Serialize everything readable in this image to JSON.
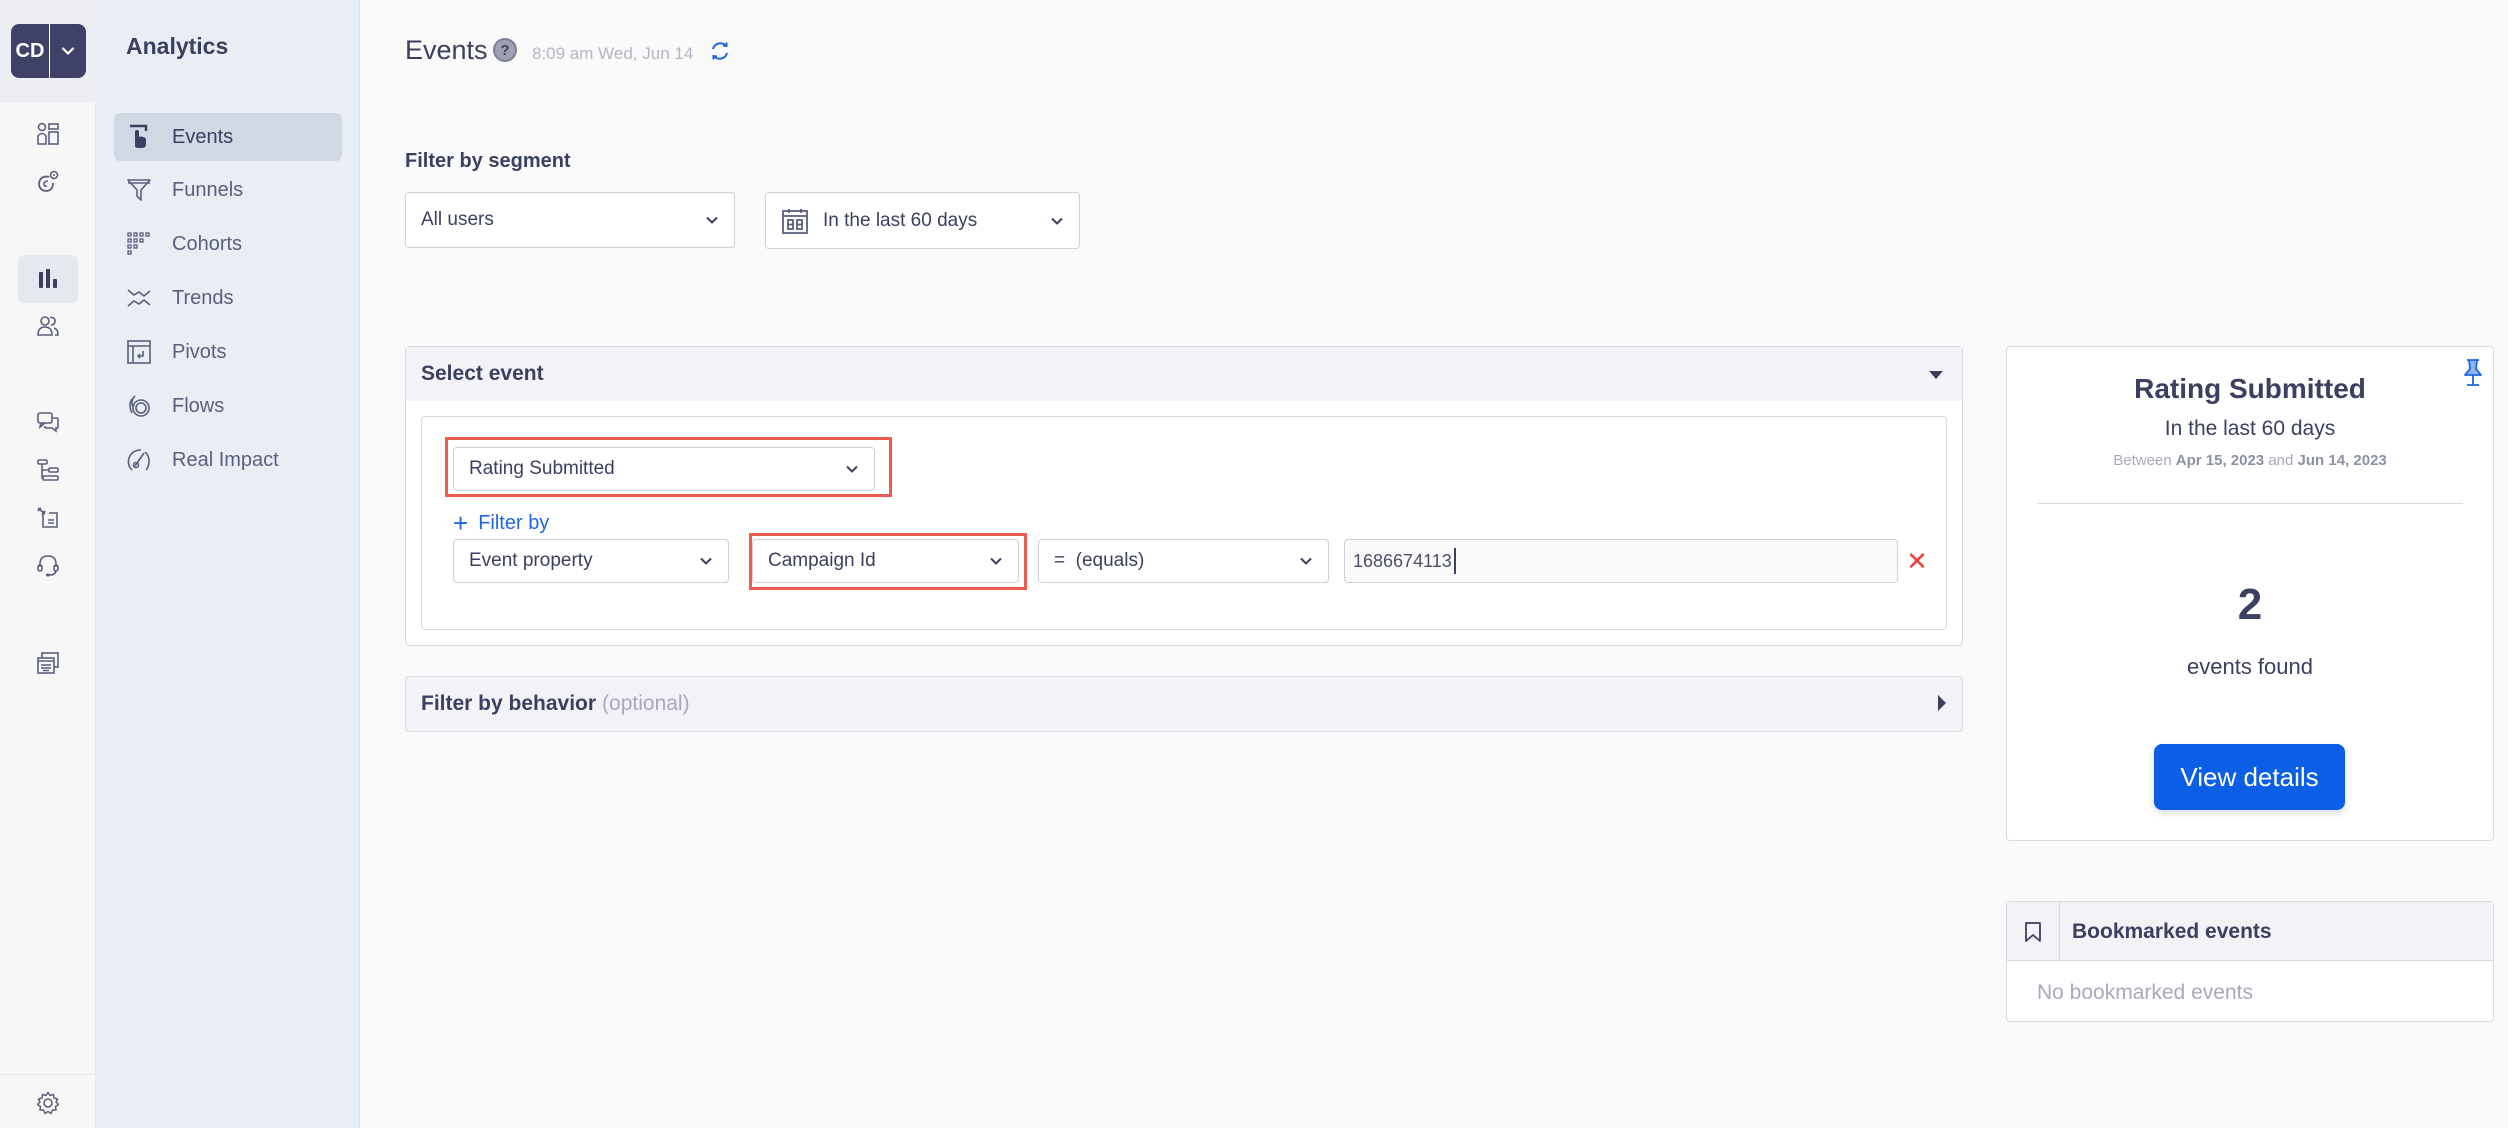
{
  "rail": {
    "logo_initials": "CD",
    "icons": [
      "dashboard-icon",
      "engagement-icon",
      "analytics-icon",
      "users-icon",
      "messages-icon",
      "journeys-icon",
      "campaigns-icon",
      "support-icon",
      "templates-icon",
      "settings-icon"
    ],
    "active": "analytics-icon"
  },
  "subnav": {
    "title": "Analytics",
    "items": [
      {
        "label": "Events",
        "icon": "tap-icon",
        "active": true
      },
      {
        "label": "Funnels",
        "icon": "funnel-icon",
        "active": false
      },
      {
        "label": "Cohorts",
        "icon": "cohorts-icon",
        "active": false
      },
      {
        "label": "Trends",
        "icon": "trends-icon",
        "active": false
      },
      {
        "label": "Pivots",
        "icon": "pivots-icon",
        "active": false
      },
      {
        "label": "Flows",
        "icon": "flows-icon",
        "active": false
      },
      {
        "label": "Real Impact",
        "icon": "real-impact-icon",
        "active": false
      }
    ]
  },
  "header": {
    "title": "Events",
    "help": "?",
    "timestamp": "8:09 am Wed, Jun 14"
  },
  "segment": {
    "label": "Filter by segment",
    "users_value": "All users",
    "date_value": "In the last 60 days"
  },
  "select_event": {
    "title": "Select event",
    "event_value": "Rating Submitted",
    "filter_by_label": "Filter by",
    "filter": {
      "type_value": "Event property",
      "property_value": "Campaign Id",
      "operator_value": "=  (equals)",
      "value": "1686674113",
      "remove_label": "✕"
    }
  },
  "behavior": {
    "title": "Filter by behavior",
    "optional": "(optional)"
  },
  "summary": {
    "title": "Rating Submitted",
    "subtitle": "In the last 60 days",
    "range_prefix": "Between",
    "range_start": "Apr 15, 2023",
    "range_mid": "and",
    "range_end": "Jun 14, 2023",
    "count": "2",
    "count_label": "events found",
    "button": "View details"
  },
  "bookmarks": {
    "title": "Bookmarked events",
    "empty": "No bookmarked events"
  },
  "colors": {
    "accent": "#0b5ee6",
    "link": "#1f66e0",
    "highlight": "#ef5c4f",
    "danger": "#f0413b",
    "text": "#3c4060"
  }
}
